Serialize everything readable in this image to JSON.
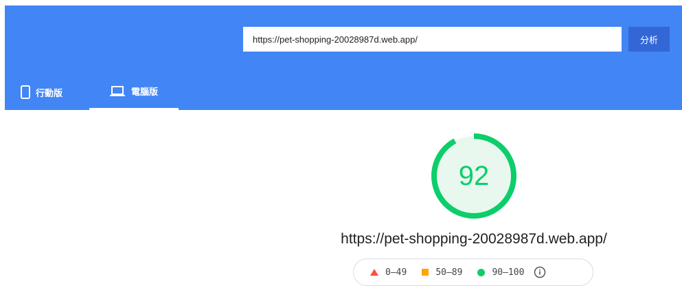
{
  "header": {
    "url_value": "https://pet-shopping-20028987d.web.app/",
    "analyze_label": "分析",
    "bg_color": "#4285f4",
    "button_color": "#3367d6"
  },
  "tabs": [
    {
      "label": "行動版",
      "icon": "phone-icon",
      "selected": false
    },
    {
      "label": "電腦版",
      "icon": "laptop-icon",
      "selected": true
    }
  ],
  "report": {
    "score": "92",
    "score_fraction": 0.92,
    "score_color": "#0cce6b",
    "url": "https://pet-shopping-20028987d.web.app/"
  },
  "legend": {
    "fail": {
      "range": "0–49",
      "icon": "triangle-icon",
      "color": "#ff4e42"
    },
    "average": {
      "range": "50–89",
      "icon": "square-icon",
      "color": "#ffa400"
    },
    "pass": {
      "range": "90–100",
      "icon": "circle-icon",
      "color": "#0cce6b"
    },
    "info_icon": "info-icon"
  }
}
